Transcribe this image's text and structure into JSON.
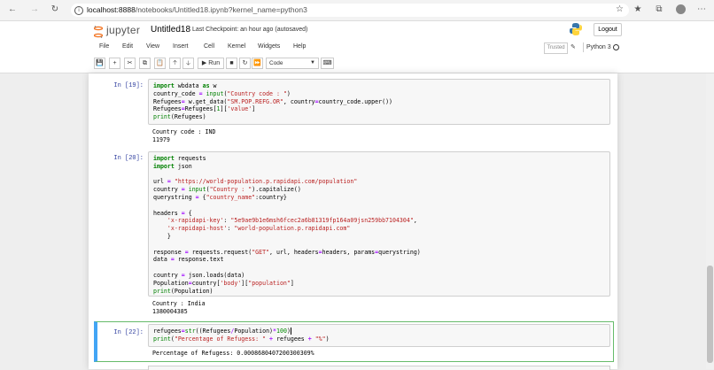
{
  "browser": {
    "url_host": "localhost:8888",
    "url_path": "/notebooks/Untitled18.ipynb?kernel_name=python3"
  },
  "header": {
    "logo_text": "jupyter",
    "notebook_title": "Untitled18",
    "checkpoint": "Last Checkpoint: an hour ago (autosaved)",
    "logout_label": "Logout"
  },
  "menu": [
    "File",
    "Edit",
    "View",
    "Insert",
    "Cell",
    "Kernel",
    "Widgets",
    "Help"
  ],
  "kernel": {
    "trusted_label": "Trusted",
    "name": "Python 3"
  },
  "toolbar": {
    "run_label": "Run",
    "cell_type": "Code"
  },
  "cells": [
    {
      "prompt": "In [19]:",
      "output": "Country code : IND\n11979"
    },
    {
      "prompt": "In [20]:",
      "output": "Country : India\n1380004385"
    },
    {
      "prompt": "In [22]:",
      "output": "Percentage of Refugess: 0.0008680407200300309%"
    }
  ]
}
